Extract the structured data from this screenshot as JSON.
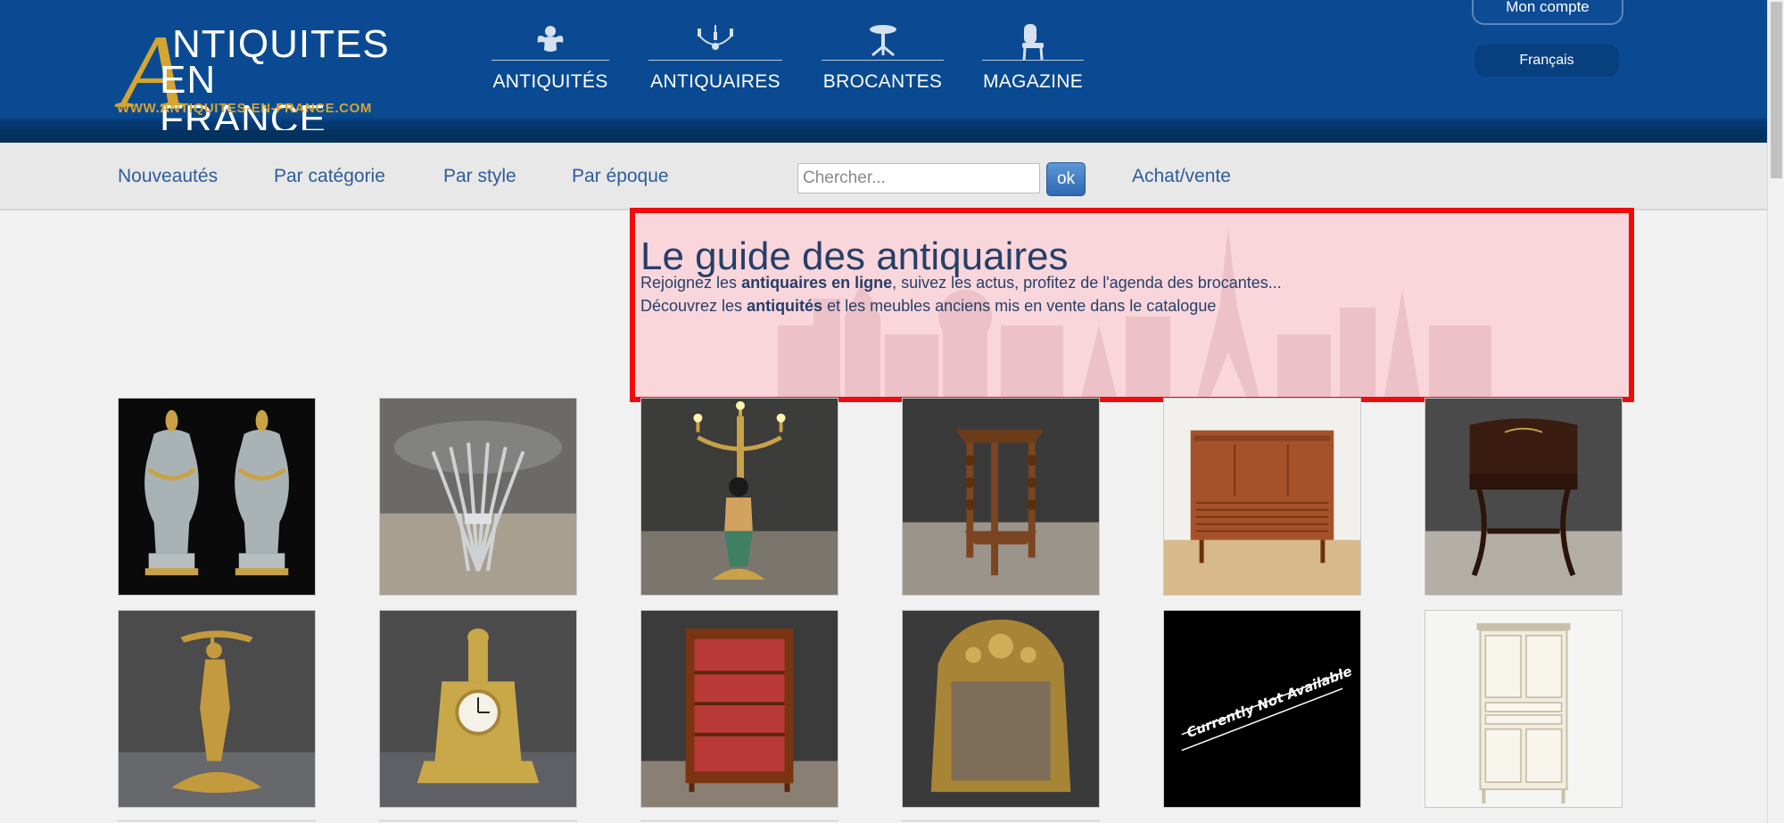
{
  "header": {
    "logo": {
      "big_letter": "A",
      "line1": "NTIQUITES",
      "line2": "EN FRANCE",
      "url": "WWW.ANTIQUITES-EN-FRANCE.COM"
    },
    "main_nav": [
      {
        "label": "ANTIQUITÉS",
        "icon": "cherub-icon"
      },
      {
        "label": "ANTIQUAIRES",
        "icon": "chandelier-icon"
      },
      {
        "label": "BROCANTES",
        "icon": "pedestal-table-icon"
      },
      {
        "label": "MAGAZINE",
        "icon": "chair-icon"
      }
    ],
    "account_label": "Mon compte",
    "language_label": "Français"
  },
  "subnav": {
    "links": [
      "Nouveautés",
      "Par catégorie",
      "Par style",
      "Par époque"
    ],
    "search_placeholder": "Chercher...",
    "search_button": "ok",
    "extra_link": "Achat/vente"
  },
  "hero": {
    "title": "Le guide des antiquaires",
    "line1_pre": "Rejoignez les ",
    "line1_bold": "antiquaires en ligne",
    "line1_post": ", suivez les actus, profitez de l'agenda des brocantes...",
    "line2_pre": "Découvrez les ",
    "line2_bold": "antiquités",
    "line2_post": " et les meubles anciens mis en vente dans le catalogue"
  },
  "products": [
    {
      "icon": "marble-urns-image"
    },
    {
      "icon": "wheat-sheaf-table-image"
    },
    {
      "icon": "blackamoor-candelabra-image"
    },
    {
      "icon": "turned-side-table-image"
    },
    {
      "icon": "teak-sideboard-image"
    },
    {
      "icon": "writing-table-image"
    },
    {
      "icon": "bronze-figure-image"
    },
    {
      "icon": "gilt-bronze-clock-image"
    },
    {
      "icon": "glass-vitrine-image"
    },
    {
      "icon": "gilt-mirror-image"
    },
    {
      "icon": "currently-not-available-image",
      "caption": "Currently Not Available"
    },
    {
      "icon": "white-cabinet-image"
    }
  ],
  "colors": {
    "header_blue": "#0b4a93",
    "gold": "#d5a531",
    "link_blue": "#2e5d9a",
    "hero_border": "#f10a0a",
    "hero_text": "#263f68"
  }
}
